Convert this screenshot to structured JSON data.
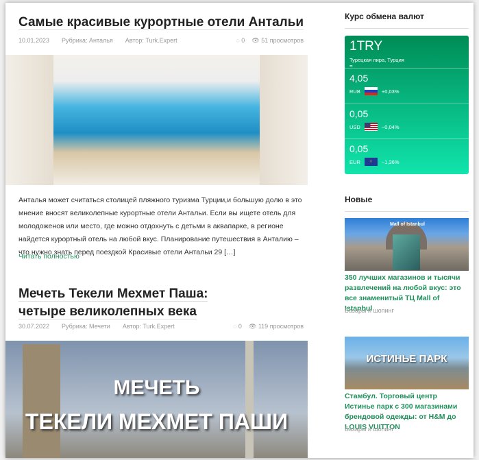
{
  "posts": [
    {
      "title": "Самые красивые курортные отели Антальи",
      "date": "10.01.2023",
      "category": "Рубрика: Анталья",
      "author": "Автор: Turk.Expert",
      "comments": "0",
      "views": "51 просмотров",
      "excerpt": "Анталья может считаться столицей пляжного туризма Турции,и большую долю в это мнение вносят великолепные курортные отели Антальи. Если вы ищете отель для молодоженов или место, где можно отдохнуть с детьми в аквапарке, в регионе найдется курортный отель на любой вкус. Планирование путешествия в Анталию – что нужно знать перед поездкой   Красивые отели Антальи 29 […]",
      "read_more": "Читать полностью"
    },
    {
      "title": "Мечеть Текели Мехмет Паша: четыре великолепных века",
      "date": "30.07.2022",
      "category": "Рубрика: Мечети",
      "author": "Автор: Turk.Expert",
      "comments": "0",
      "views": "119 просмотров",
      "image_text_1": "МЕЧЕТЬ",
      "image_text_2": "ТЕКЕЛИ МЕХМЕТ ПАШИ"
    }
  ],
  "sidebar": {
    "currency_heading": "Курс обмена валют",
    "base": {
      "amount": "1TRY",
      "name": "Турецкая лира, Турция",
      "eq": "="
    },
    "rates": [
      {
        "value": "4,05",
        "code": "RUB",
        "change": "+0,03%",
        "flag": "russia"
      },
      {
        "value": "0,05",
        "code": "USD",
        "change": "−0,04%",
        "flag": "usa"
      },
      {
        "value": "0,05",
        "code": "EUR",
        "change": "−1,36%",
        "flag": "eu"
      }
    ],
    "new_heading": "Новые",
    "items": [
      {
        "title": "350 лучших магазинов и тысячи развлечений на любой вкус: это все знаменитый ТЦ Mall of Istanbul",
        "category": "Базары и шопинг",
        "image_text": "Mall of Istanbul"
      },
      {
        "title": "Стамбул. Торговый центр Истинье парк с 300 магазинами брендовой одежды: от H&M до LOUIS VUITTON",
        "category": "Базары и шопинг",
        "image_text": "ИСТИНЬЕ ПАРК"
      }
    ]
  },
  "colors": {
    "accent": "#1f8f5b",
    "widget_top": "#008c56",
    "widget_bottom": "#10e4ac"
  }
}
